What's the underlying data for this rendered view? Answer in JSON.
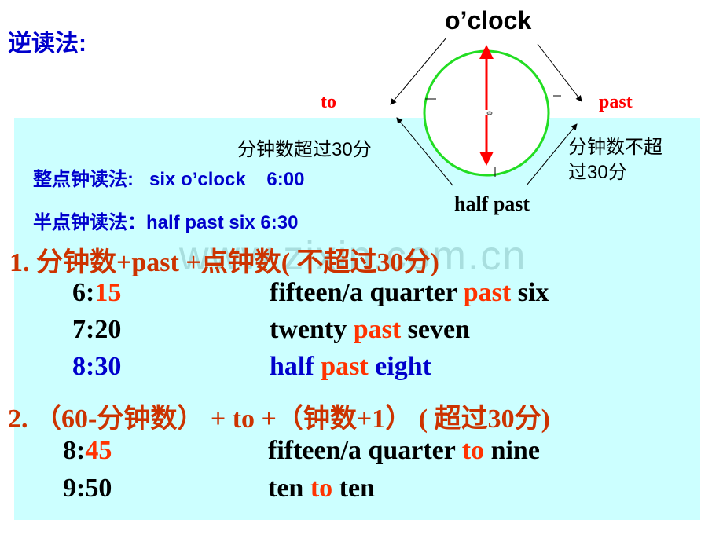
{
  "heading": "逆读法:",
  "clock_diagram": {
    "top_label": "o’clock",
    "left_label": "to",
    "right_label": "past",
    "bottom_label": "half past",
    "left_note": "分钟数超过30分",
    "right_note_line1": "分钟数不超",
    "right_note_line2": "过30分",
    "colors": {
      "ring": "#22dd22",
      "hand": "#ff0000",
      "arrows": "#000000"
    }
  },
  "basic_readings": [
    {
      "label": "整点钟读法:",
      "example": "six o’clock",
      "time": "6:00"
    },
    {
      "label": "半点钟读法：",
      "example": "half past six",
      "time": "6:30"
    }
  ],
  "watermark": "www.zixin.com.cn",
  "rule1": {
    "title": "1. 分钟数+past +点钟数( 不超过30分)",
    "examples": [
      {
        "time_h": "6:",
        "time_m": "15",
        "pre": "fifteen/a quarter ",
        "key": "past",
        "post": " six"
      },
      {
        "time_h": "7:",
        "time_m": "20",
        "pre": "twenty ",
        "key": "past",
        "post": " seven"
      },
      {
        "time_h": "8:",
        "time_m": "30",
        "pre": "half ",
        "key": "past",
        "post": " eight"
      }
    ]
  },
  "rule2": {
    "title": "2. （60-分钟数） + to +（钟数+1） ( 超过30分)",
    "examples": [
      {
        "time_h": "8:",
        "time_m": "45",
        "pre": "fifteen/a quarter ",
        "key": "to",
        "post": " nine"
      },
      {
        "time_h": "9:",
        "time_m": "50",
        "pre": "ten ",
        "key": "to",
        "post": " ten"
      }
    ]
  },
  "colors": {
    "panel": "#ccffff",
    "heading": "#0000cc",
    "rule": "#cc3300",
    "highlight": "#ff3300"
  }
}
